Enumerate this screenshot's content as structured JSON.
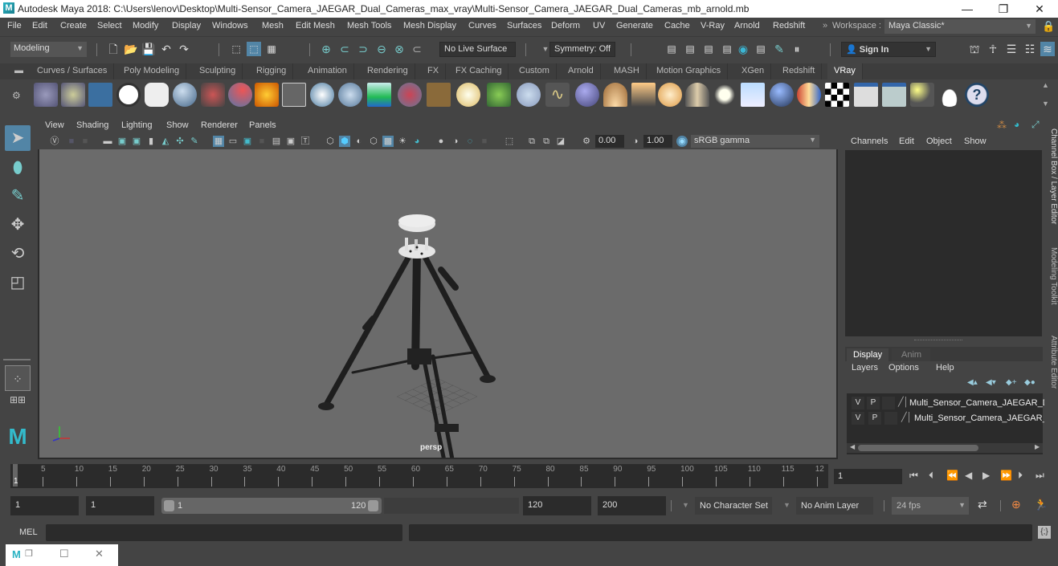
{
  "window": {
    "title": "Autodesk Maya 2018: C:\\Users\\lenov\\Desktop\\Multi-Sensor_Camera_JAEGAR_Dual_Cameras_max_vray\\Multi-Sensor_Camera_JAEGAR_Dual_Cameras_mb_arnold.mb",
    "logo": "M",
    "minimize": "—",
    "restore": "❐",
    "close": "✕"
  },
  "menubar": {
    "items": [
      "File",
      "Edit",
      "Create",
      "Select",
      "Modify",
      "Display",
      "Windows",
      "Mesh",
      "Edit Mesh",
      "Mesh Tools",
      "Mesh Display",
      "Curves",
      "Surfaces",
      "Deform",
      "UV",
      "Generate",
      "Cache",
      "V-Ray",
      "Arnold",
      "Redshift"
    ],
    "workspace_label": "Workspace :",
    "workspace_value": "Maya Classic*"
  },
  "statusline": {
    "mode": "Modeling",
    "live_surface": "No Live Surface",
    "symmetry": "Symmetry: Off",
    "sign_in": "Sign In"
  },
  "shelf": {
    "tabs": [
      "Curves / Surfaces",
      "Poly Modeling",
      "Sculpting",
      "Rigging",
      "Animation",
      "Rendering",
      "FX",
      "FX Caching",
      "Custom",
      "Arnold",
      "MASH",
      "Motion Graphics",
      "XGen",
      "Redshift",
      "VRay"
    ],
    "active_tab": "VRay"
  },
  "viewport": {
    "menus": [
      "View",
      "Shading",
      "Lighting",
      "Show",
      "Renderer",
      "Panels"
    ],
    "exposure": "0.00",
    "gamma": "1.00",
    "color_space": "sRGB gamma",
    "camera_label": "persp"
  },
  "channelbox": {
    "menus": [
      "Channels",
      "Edit",
      "Object",
      "Show"
    ]
  },
  "layer_editor": {
    "tabs": [
      "Display",
      "Anim"
    ],
    "active_tab": "Display",
    "menus": [
      "Layers",
      "Options",
      "Help"
    ],
    "layers": [
      {
        "v": "V",
        "p": "P",
        "name": "Multi_Sensor_Camera_JAEGAR_D"
      },
      {
        "v": "V",
        "p": "P",
        "name": "Multi_Sensor_Camera_JAEGAR_"
      }
    ]
  },
  "side_tabs": [
    "Channel Box / Layer Editor",
    "Modeling Toolkit",
    "Attribute Editor"
  ],
  "timeline": {
    "ticks": [
      "5",
      "10",
      "15",
      "20",
      "25",
      "30",
      "35",
      "40",
      "45",
      "50",
      "55",
      "60",
      "65",
      "70",
      "75",
      "80",
      "85",
      "90",
      "95",
      "100",
      "105",
      "110",
      "115",
      "12"
    ],
    "current_frame_marker": "1",
    "current_frame": "1"
  },
  "range": {
    "start": "1",
    "playback_start": "1",
    "slider_min": "1",
    "slider_max": "120",
    "playback_end": "120",
    "end": "200",
    "character_set": "No Character Set",
    "anim_layer": "No Anim Layer",
    "fps": "24 fps"
  },
  "cmdline": {
    "label": "MEL"
  }
}
